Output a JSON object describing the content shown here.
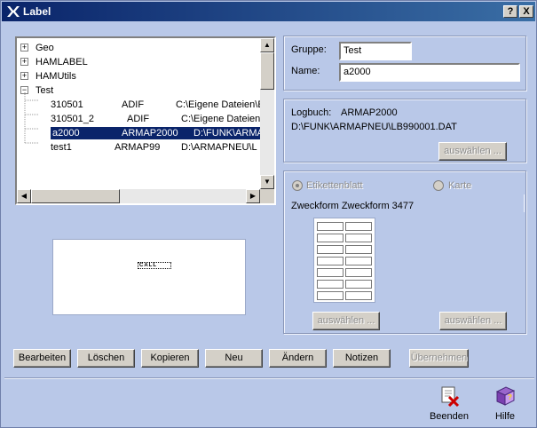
{
  "window": {
    "title": "Label",
    "help_btn": "?",
    "close_btn": "X"
  },
  "tree": {
    "nodes": [
      {
        "label": "Geo",
        "expander": "+",
        "level": 0
      },
      {
        "label": "HAMLABEL",
        "expander": "+",
        "level": 0
      },
      {
        "label": "HAMUtils",
        "expander": "+",
        "level": 0
      },
      {
        "label": "Test",
        "expander": "−",
        "level": 0
      },
      {
        "label": "310501",
        "format": "ADIF",
        "path": "C:\\Eigene Dateien\\E",
        "level": 1
      },
      {
        "label": "310501_2",
        "format": "ADIF",
        "path": "C:\\Eigene Dateien\\",
        "level": 1
      },
      {
        "label": "a2000",
        "format": "ARMAP2000",
        "path": "D:\\FUNK\\ARMA",
        "level": 1,
        "selected": true
      },
      {
        "label": "test1",
        "format": "ARMAP99",
        "path": "D:\\ARMAPNEU\\L",
        "level": 1
      }
    ]
  },
  "preview": {
    "label_text": "CALL"
  },
  "group_name": {
    "gruppe_label": "Gruppe:",
    "gruppe_value": "Test",
    "name_label": "Name:",
    "name_value": "a2000"
  },
  "logbuch": {
    "label": "Logbuch:",
    "value": "ARMAP2000",
    "path": "D:\\FUNK\\ARMAPNEU\\LB990001.DAT",
    "select_btn": "auswählen ..."
  },
  "layout_box": {
    "radio_etikettenblatt": "Etikettenblatt",
    "radio_karte": "Karte",
    "format_text": "Zweckform Zweckform 3477",
    "select_left_btn": "auswählen ...",
    "select_right_btn": "auswählen ..."
  },
  "buttons": {
    "bearbeiten": "Bearbeiten",
    "loeschen": "Löschen",
    "kopieren": "Kopieren",
    "neu": "Neu",
    "aendern": "Ändern",
    "notizen": "Notizen",
    "uebernehmen": "Übernehmen"
  },
  "bottom": {
    "beenden": "Beenden",
    "hilfe": "Hilfe"
  },
  "colors": {
    "background": "#b9c8e8",
    "titlebar": "#0a246a",
    "selection": "#0a246a"
  }
}
